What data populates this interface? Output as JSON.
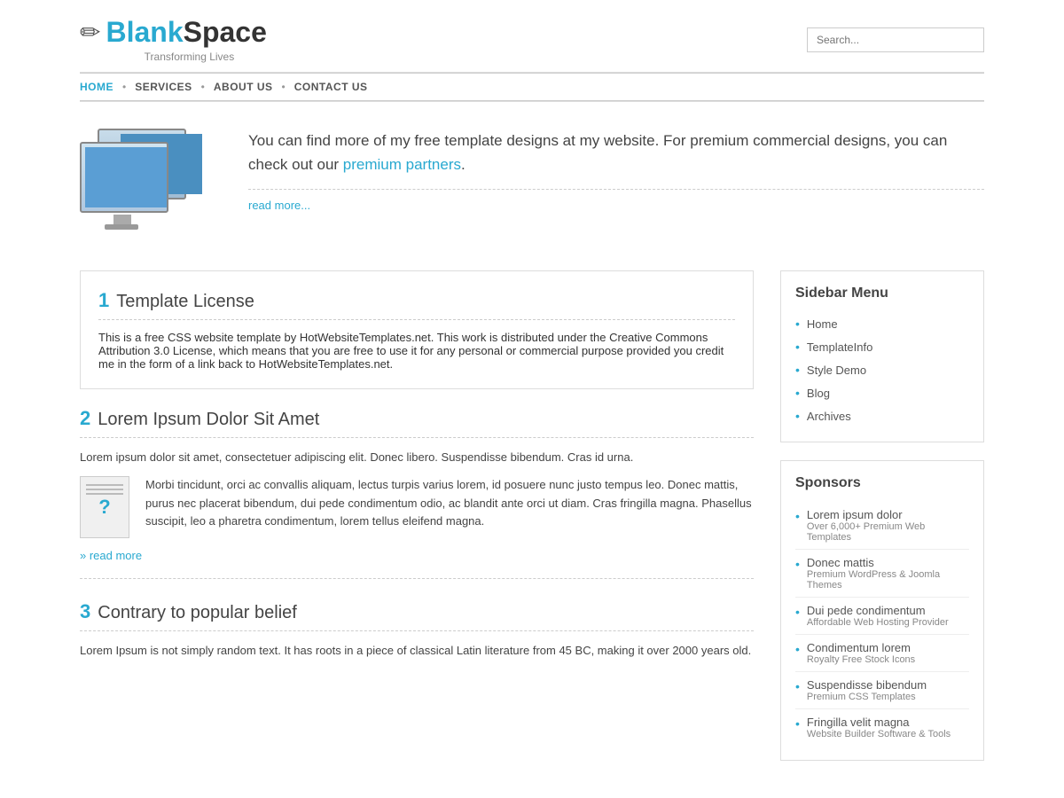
{
  "header": {
    "logo_blank": "Blank",
    "logo_space": "Space",
    "tagline": "Transforming Lives",
    "search_placeholder": "Search..."
  },
  "nav": {
    "items": [
      {
        "label": "HOME",
        "active": true
      },
      {
        "label": "SERVICES",
        "active": false
      },
      {
        "label": "ABOUT US",
        "active": false
      },
      {
        "label": "CONTACT US",
        "active": false
      }
    ]
  },
  "hero": {
    "text": "You can find more of my free template designs at my website. For premium commercial designs, you can check out our ",
    "link_text": "premium partners",
    "text_end": ".",
    "read_more": "read more..."
  },
  "posts": [
    {
      "num": "1",
      "title": "Template License",
      "body": "This is a free CSS website template by HotWebsiteTemplates.net. This work is distributed under the Creative Commons Attribution 3.0 License, which means that you are free to use it for any personal or commercial purpose provided you credit me in the form of a link back to HotWebsiteTemplates.net.",
      "has_image": false
    },
    {
      "num": "2",
      "title": "Lorem Ipsum Dolor Sit Amet",
      "body_before": "Lorem ipsum dolor sit amet, consectetuer adipiscing elit. Donec libero. Suspendisse bibendum. Cras id urna.",
      "body_after": "Morbi tincidunt, orci ac convallis aliquam, lectus turpis varius lorem, id posuere nunc justo tempus leo. Donec mattis, purus nec placerat bibendum, dui pede condimentum odio, ac blandit ante orci ut diam. Cras fringilla magna. Phasellus suscipit, leo a pharetra condimentum, lorem tellus eleifend magna.",
      "has_image": true,
      "read_more": "» read more"
    },
    {
      "num": "3",
      "title": "Contrary to popular belief",
      "body": "Lorem Ipsum is not simply random text. It has roots in a piece of classical Latin literature from 45 BC, making it over 2000 years old.",
      "has_image": false
    }
  ],
  "sidebar": {
    "menu_title": "Sidebar Menu",
    "menu_items": [
      {
        "label": "Home"
      },
      {
        "label": "TemplateInfo"
      },
      {
        "label": "Style Demo"
      },
      {
        "label": "Blog"
      },
      {
        "label": "Archives"
      }
    ],
    "sponsors_title": "Sponsors",
    "sponsors": [
      {
        "main": "Lorem ipsum dolor",
        "sub": "Over 6,000+ Premium Web Templates"
      },
      {
        "main": "Donec mattis",
        "sub": "Premium WordPress & Joomla Themes"
      },
      {
        "main": "Dui pede condimentum",
        "sub": "Affordable Web Hosting Provider"
      },
      {
        "main": "Condimentum lorem",
        "sub": "Royalty Free Stock Icons"
      },
      {
        "main": "Suspendisse bibendum",
        "sub": "Premium CSS Templates"
      },
      {
        "main": "Fringilla velit magna",
        "sub": "Website Builder Software & Tools"
      }
    ]
  }
}
